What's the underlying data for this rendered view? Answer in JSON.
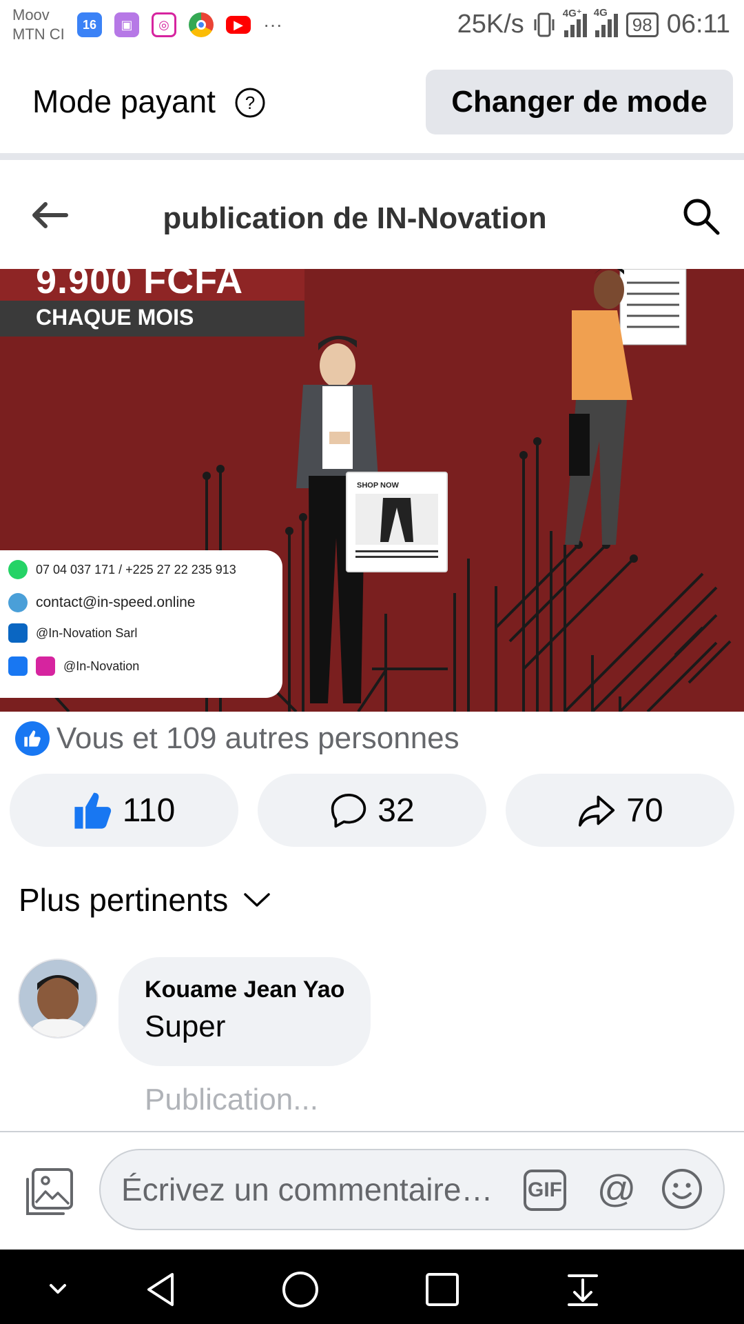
{
  "status_bar": {
    "carrier_line1": "Moov",
    "carrier_line2": "MTN CI",
    "speed": "25K/s",
    "battery": "98",
    "time": "06:11",
    "net1": "4G⁺",
    "net2": "4G",
    "more": "···",
    "app_icons": [
      "calendar-16-icon",
      "gallery-icon",
      "instagram-icon",
      "chrome-icon",
      "youtube-icon"
    ]
  },
  "mode_bar": {
    "label": "Mode payant",
    "help": "?",
    "change_button": "Changer de mode"
  },
  "header": {
    "title": "publication de IN-Novation"
  },
  "post_image": {
    "price": "9.900 FCFA",
    "period": "CHAQUE MOIS",
    "contacts": {
      "phone": "07 04 037 171 / +225 27 22 235 913",
      "email": "contact@in-speed.online",
      "linkedin": "@In-Novation Sarl",
      "social": "@In-Novation"
    },
    "shop_label": "SHOP NOW",
    "background_color": "#7a1f1f"
  },
  "reactions": {
    "summary": "Vous et 109 autres personnes"
  },
  "actions": {
    "like_count": "110",
    "comment_count": "32",
    "share_count": "70"
  },
  "sort": {
    "label": "Plus pertinents"
  },
  "comment": {
    "author": "Kouame Jean Yao",
    "text": "Super",
    "status": "Publication..."
  },
  "composer": {
    "placeholder": "Écrivez un commentaire…",
    "gif_label": "GIF",
    "at_label": "@"
  },
  "colors": {
    "accent": "#1877f2",
    "button_bg": "#f0f2f5",
    "secondary_text": "#65676b"
  }
}
